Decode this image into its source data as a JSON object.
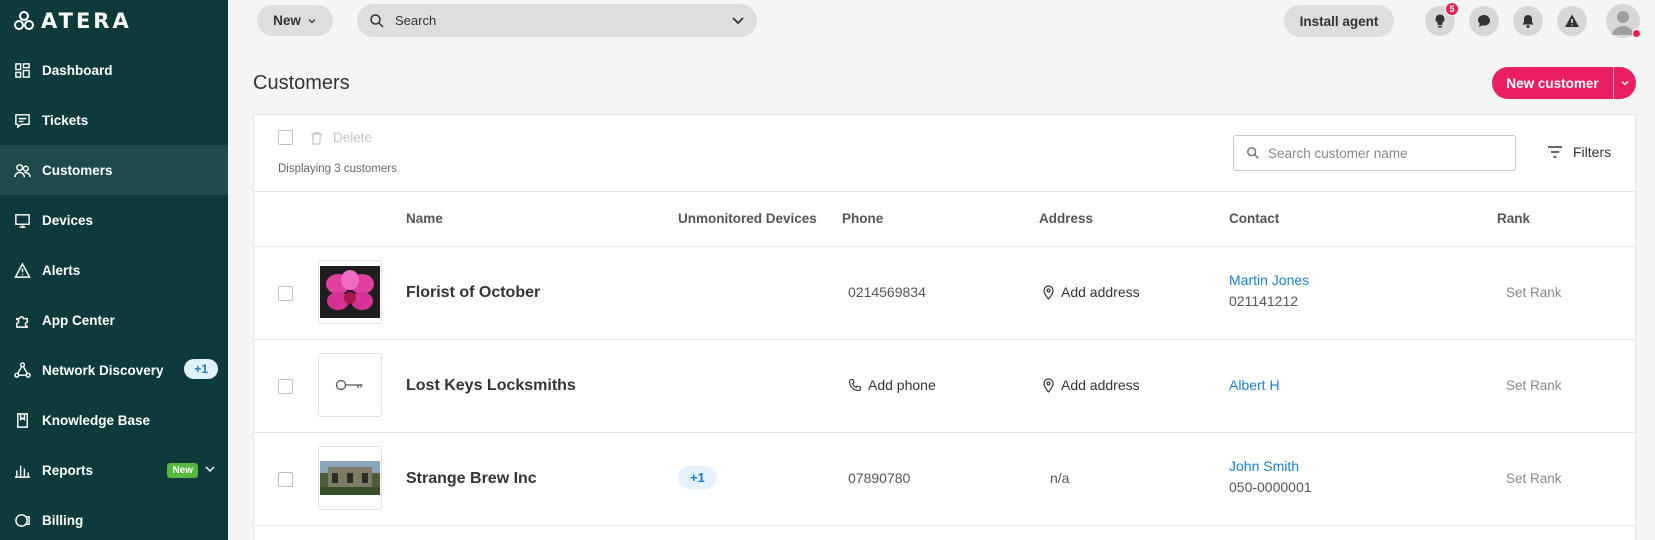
{
  "brand": {
    "name": "ATERA"
  },
  "sidebar": {
    "items": [
      {
        "label": "Dashboard",
        "icon": "dashboard-icon"
      },
      {
        "label": "Tickets",
        "icon": "tickets-icon"
      },
      {
        "label": "Customers",
        "icon": "customers-icon",
        "active": true
      },
      {
        "label": "Devices",
        "icon": "devices-icon"
      },
      {
        "label": "Alerts",
        "icon": "alerts-icon"
      },
      {
        "label": "App Center",
        "icon": "app-center-icon"
      },
      {
        "label": "Network Discovery",
        "icon": "network-discovery-icon",
        "badge": "+1"
      },
      {
        "label": "Knowledge Base",
        "icon": "knowledge-base-icon"
      },
      {
        "label": "Reports",
        "icon": "reports-icon",
        "badge": "New"
      },
      {
        "label": "Billing",
        "icon": "billing-icon"
      }
    ]
  },
  "topbar": {
    "new_label": "New",
    "search_label": "Search",
    "install_label": "Install agent",
    "tips_count": "5"
  },
  "page": {
    "title": "Customers",
    "new_customer_label": "New customer",
    "delete_label": "Delete",
    "displaying": "Displaying 3 customers",
    "search_placeholder": "Search customer name",
    "filters_label": "Filters"
  },
  "table": {
    "columns": [
      "Name",
      "Unmonitored Devices",
      "Phone",
      "Address",
      "Contact",
      "Rank"
    ],
    "rows": [
      {
        "name": "Florist of October",
        "unmonitored": "",
        "phone": "0214569834",
        "phone_is_action": false,
        "address": "Add address",
        "address_is_action": true,
        "contact_name": "Martin Jones",
        "contact_phone": "021141212",
        "rank": "Set Rank"
      },
      {
        "name": "Lost Keys Locksmiths",
        "unmonitored": "",
        "phone": "Add phone",
        "phone_is_action": true,
        "address": "Add address",
        "address_is_action": true,
        "contact_name": "Albert H",
        "contact_phone": "",
        "rank": "Set Rank"
      },
      {
        "name": "Strange Brew Inc",
        "unmonitored": "+1",
        "phone": "07890780",
        "phone_is_action": false,
        "address": "n/a",
        "address_is_action": false,
        "contact_name": "John Smith",
        "contact_phone": "050-0000001",
        "rank": "Set Rank"
      }
    ]
  },
  "colors": {
    "sidebar": "#0d3b3b",
    "accent": "#e91e63",
    "link": "#1a7fd1"
  }
}
